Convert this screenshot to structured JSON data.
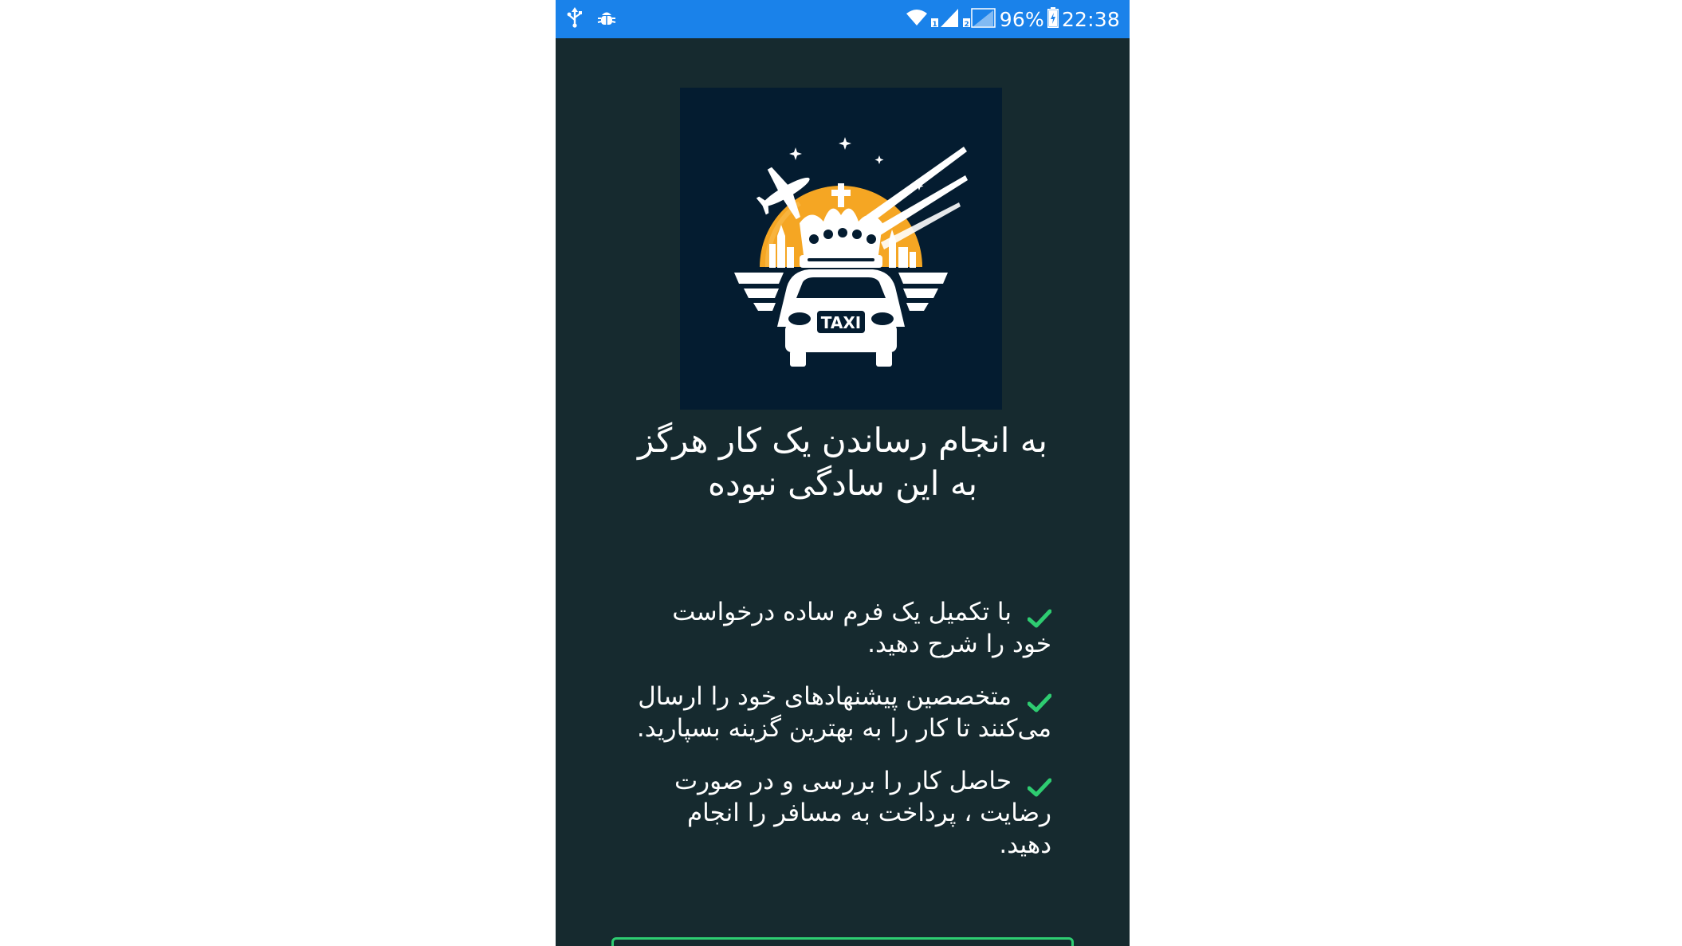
{
  "status_bar": {
    "left_icons": [
      "usb-icon",
      "bug-icon"
    ],
    "right_icons": [
      "wifi-icon",
      "signal-sim1-icon",
      "signal-sim2-icon",
      "battery-charging-icon"
    ],
    "battery": "96%",
    "time": "22:38",
    "background": "#1a82ea"
  },
  "logo": {
    "icon": "taxi-crown-logo",
    "text": "TAXI",
    "colors": {
      "background": "#041c30",
      "sun": "#f5a623",
      "white": "#ffffff"
    }
  },
  "headline": {
    "line1": "به انجام رساندن یک کار هرگز",
    "line2": "به این سادگی نبوده"
  },
  "features": [
    {
      "icon": "check-icon",
      "text": "با تکمیل یک فرم ساده درخواست خود را شرح دهید."
    },
    {
      "icon": "check-icon",
      "text": "متخصصین پیشنهادهای خود را ارسال می‌کنند تا کار را به بهترین گزینه بسپارید."
    },
    {
      "icon": "check-icon",
      "text": "حاصل کار را بررسی و در صورت رضایت ، پرداخت به مسافر را انجام دهید."
    }
  ],
  "colors": {
    "screen_background": "#162a2f",
    "accent_green": "#2ecc71"
  }
}
